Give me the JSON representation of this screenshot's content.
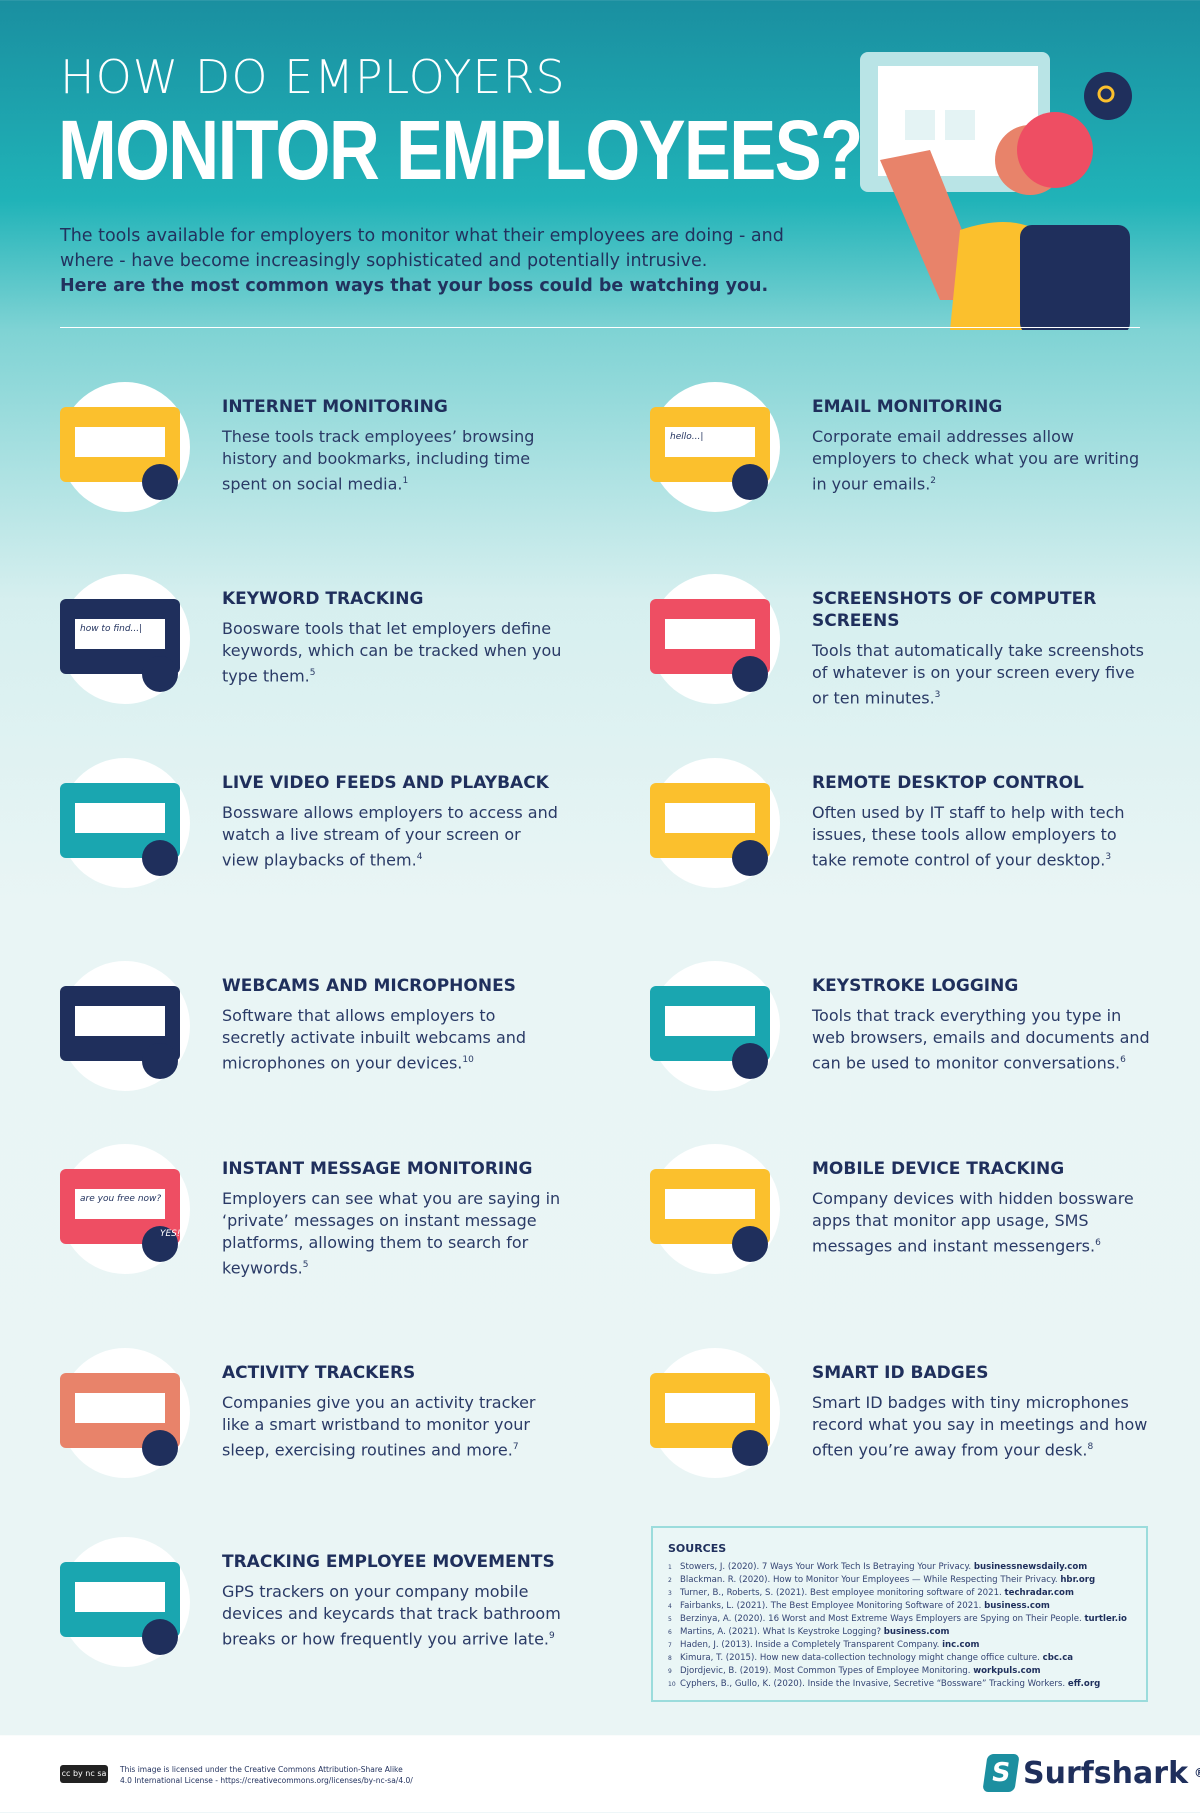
{
  "header": {
    "title_small": "HOW DO EMPLOYERS",
    "title_big": "MONITOR EMPLOYEES?",
    "intro": "The tools available for employers to monitor what their employees are doing - and where - have become increasingly sophisticated and potentially intrusive.",
    "intro_bold": "Here are the most common ways that your boss could be watching you."
  },
  "items": [
    {
      "title": "INTERNET MONITORING",
      "text": "These tools track employees’ browsing history and bookmarks, including time spent on social media.",
      "ref": "1"
    },
    {
      "title": "EMAIL MONITORING",
      "text": "Corporate email addresses allow employers to check what you are writing in your emails.",
      "ref": "2",
      "icon_text": "hello...|"
    },
    {
      "title": "KEYWORD TRACKING",
      "text": "Boosware tools that let employers define keywords, which can be tracked when you type them.",
      "ref": "5",
      "icon_text": "how to find...|"
    },
    {
      "title": "SCREENSHOTS OF COMPUTER SCREENS",
      "text": "Tools that automatically take screenshots of whatever is on your screen every five or ten minutes.",
      "ref": "3"
    },
    {
      "title": "LIVE VIDEO FEEDS AND PLAYBACK",
      "text": "Bossware allows employers to access and watch a live stream of your screen or view playbacks of them.",
      "ref": "4"
    },
    {
      "title": "REMOTE DESKTOP CONTROL",
      "text": "Often used by IT staff to help with tech issues, these tools allow employers to take remote control of your desktop.",
      "ref": "3"
    },
    {
      "title": "WEBCAMS AND MICROPHONES",
      "text": "Software that allows employers to secretly activate inbuilt webcams and microphones on your devices.",
      "ref": "10"
    },
    {
      "title": "KEYSTROKE LOGGING",
      "text": "Tools that track everything you type in web browsers, emails and documents and can be used to monitor conversations.",
      "ref": "6"
    },
    {
      "title": "INSTANT MESSAGE MONITORING",
      "text": "Employers can see what you are saying in ‘private’ messages on instant message platforms, allowing them to search for keywords.",
      "ref": "5",
      "icon_text": "are you free now?",
      "icon_text2": "YES!"
    },
    {
      "title": "MOBILE DEVICE TRACKING",
      "text": "Company devices with hidden bossware apps that monitor app usage, SMS messages and instant messengers.",
      "ref": "6"
    },
    {
      "title": "ACTIVITY TRACKERS",
      "text": "Companies give you an activity tracker like a smart wristband to monitor your sleep, exercising routines and more.",
      "ref": "7"
    },
    {
      "title": "SMART ID BADGES",
      "text": "Smart ID badges with tiny microphones record what you say in meetings and how often you’re away from your desk.",
      "ref": "8"
    },
    {
      "title": "TRACKING EMPLOYEE MOVEMENTS",
      "text": "GPS trackers on your company mobile devices and keycards that track bathroom breaks or how frequently you arrive late.",
      "ref": "9"
    }
  ],
  "sources": {
    "title": "SOURCES",
    "list": [
      {
        "n": "1",
        "text": "Stowers, J. (2020). 7 Ways Your Work Tech Is Betraying Your Privacy.",
        "site": "businessnewsdaily.com"
      },
      {
        "n": "2",
        "text": "Blackman. R. (2020). How to Monitor Your Employees — While Respecting Their Privacy.",
        "site": "hbr.org"
      },
      {
        "n": "3",
        "text": "Turner, B., Roberts, S. (2021). Best employee monitoring software of 2021.",
        "site": "techradar.com"
      },
      {
        "n": "4",
        "text": "Fairbanks, L. (2021). The Best Employee Monitoring Software of 2021.",
        "site": "business.com"
      },
      {
        "n": "5",
        "text": "Berzinya, A. (2020). 16 Worst and Most Extreme Ways Employers are Spying on Their People.",
        "site": "turtler.io"
      },
      {
        "n": "6",
        "text": "Martins, A. (2021). What Is Keystroke Logging?",
        "site": "business.com"
      },
      {
        "n": "7",
        "text": "Haden, J. (2013). Inside a Completely Transparent Company.",
        "site": "inc.com"
      },
      {
        "n": "8",
        "text": "Kimura, T. (2015). How new data-collection technology might change office culture.",
        "site": "cbc.ca"
      },
      {
        "n": "9",
        "text": "Djordjevic, B. (2019). Most Common Types of Employee Monitoring.",
        "site": "workpuls.com"
      },
      {
        "n": "10",
        "text": "Cyphers, B., Gullo, K. (2020). Inside the Invasive, Secretive “Bossware” Tracking Workers.",
        "site": "eff.org"
      }
    ]
  },
  "footer": {
    "license_line1": "This image is licensed under the Creative Commons Attribution-Share Alike",
    "license_line2": "4.0 International License - https://creativecommons.org/licenses/by-nc-sa/4.0/",
    "cc_badge": "cc by nc sa",
    "brand": "Surfshark",
    "brand_mark": "®"
  },
  "colors": {
    "teal": "#1a8fa0",
    "navy": "#1f2f5c",
    "yellow": "#fbc02d",
    "pink": "#ee4e63",
    "green": "#1fa463"
  }
}
